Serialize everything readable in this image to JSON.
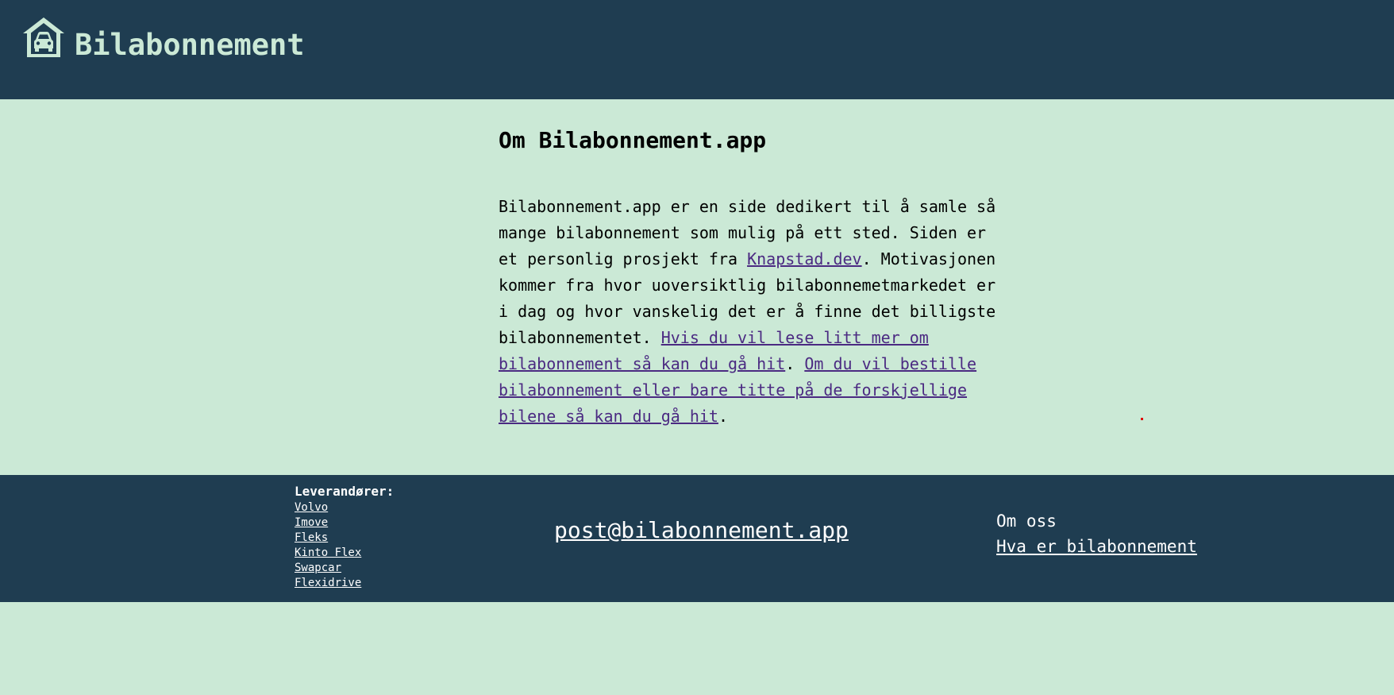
{
  "header": {
    "title": "Bilabonnement",
    "logo_icon": "house-car-icon"
  },
  "main": {
    "title": "Om Bilabonnement.app",
    "paragraph": {
      "part1": "Bilabonnement.app er en side dedikert til å samle så mange bilabonnement som mulig på ett sted. Siden er et personlig prosjekt fra ",
      "link1": "Knapstad.dev",
      "part2": ". Motivasjonen kommer fra hvor uoversiktlig bilabonnemetmarkedet er i dag og hvor vanskelig det er å finne det billigste bilabonnementet. ",
      "link2": "Hvis du vil lese litt mer om bilabonnement så kan du gå hit",
      "part3": ". ",
      "link3": "Om du vil bestille bilabonnement eller bare titte på de forskjellige bilene så kan du gå hit",
      "part4": "."
    }
  },
  "footer": {
    "suppliers_heading": "Leverandører:",
    "suppliers": [
      "Volvo",
      "Imove",
      "Fleks",
      "Kinto Flex",
      "Swapcar",
      "Flexidrive"
    ],
    "email": "post@bilabonnement.app",
    "about_label": "Om oss",
    "what_is_link": "Hva er bilabonnement"
  },
  "colors": {
    "header_bg": "#1f3d51",
    "page_bg": "#cbe9d6",
    "link": "#4b2a82"
  }
}
